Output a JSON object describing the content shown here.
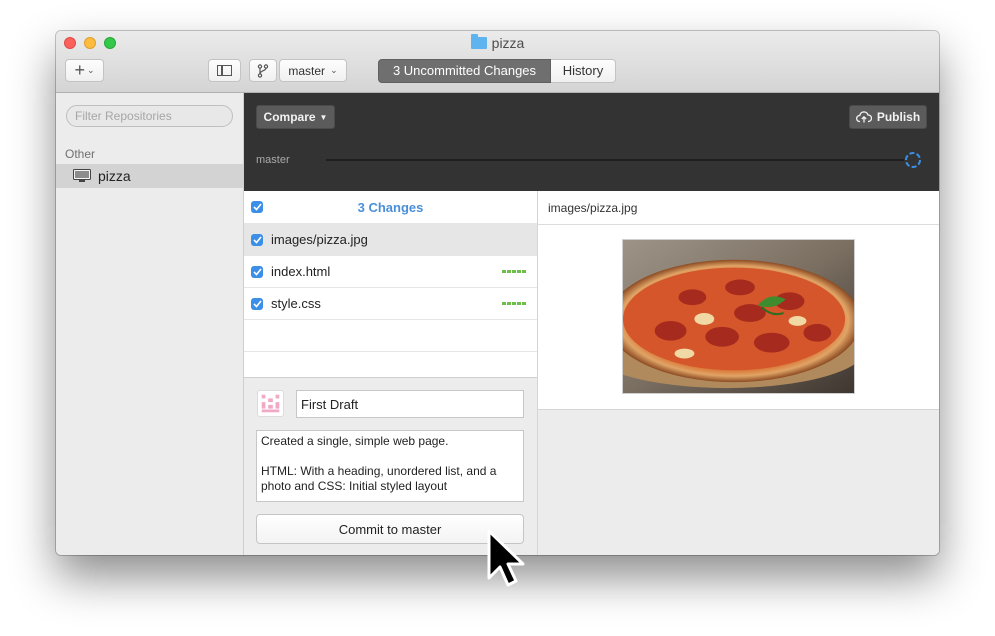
{
  "window": {
    "title": "pizza",
    "title_icon": "folder-icon"
  },
  "toolbar": {
    "add_icon": "plus-icon",
    "sidebar_toggle_icon": "sidebar-icon",
    "branch_icon": "branch-icon",
    "branch_selected": "master",
    "tabs": [
      {
        "label": "3 Uncommitted Changes",
        "active": true
      },
      {
        "label": "History",
        "active": false
      }
    ]
  },
  "sidebar": {
    "filter_placeholder": "Filter Repositories",
    "section_label": "Other",
    "repositories": [
      {
        "name": "pizza",
        "icon": "computer-icon",
        "selected": true
      }
    ]
  },
  "branch_header": {
    "compare_label": "Compare",
    "publish_label": "Publish",
    "publish_icon": "cloud-upload-icon",
    "branch_name": "master"
  },
  "changes": {
    "title": "3 Changes",
    "files": [
      {
        "path": "images/pizza.jpg",
        "checked": true,
        "selected": true,
        "diff_blocks": 0
      },
      {
        "path": "index.html",
        "checked": true,
        "selected": false,
        "diff_blocks": 5
      },
      {
        "path": "style.css",
        "checked": true,
        "selected": false,
        "diff_blocks": 5
      }
    ]
  },
  "commit": {
    "summary": "First Draft",
    "description": "Created a single, simple web page.\n\nHTML: With a heading, unordered list, and a photo and CSS: Initial styled layout",
    "button_label": "Commit to master"
  },
  "diff": {
    "file_path": "images/pizza.jpg",
    "preview_icon": "pizza-photo"
  },
  "colors": {
    "accent": "#3b8fe6",
    "changes_title": "#4a90d9",
    "diff_added": "#6cc04a",
    "dark_header": "#333333",
    "active_tab": "#6f6f6f"
  }
}
